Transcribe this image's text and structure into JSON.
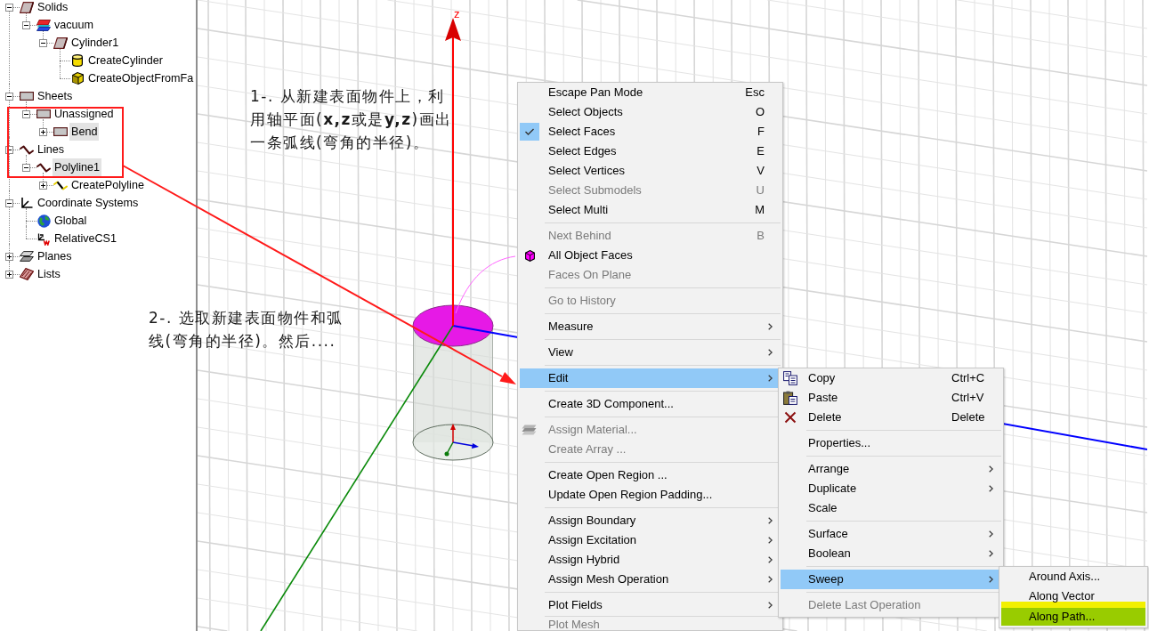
{
  "tree": [
    {
      "label": "Solids",
      "kind": "solid",
      "expanded": true,
      "selected": false,
      "children": [
        {
          "label": "vacuum",
          "kind": "material",
          "expanded": true,
          "selected": false,
          "children": [
            {
              "label": "Cylinder1",
              "kind": "solid",
              "expanded": true,
              "selected": false,
              "children": [
                {
                  "label": "CreateCylinder",
                  "kind": "cylinder",
                  "selected": false
                },
                {
                  "label": "CreateObjectFromFa",
                  "kind": "block",
                  "selected": false
                }
              ]
            }
          ]
        }
      ]
    },
    {
      "label": "Sheets",
      "kind": "sheet",
      "expanded": true,
      "selected": false,
      "children": [
        {
          "label": "Unassigned",
          "kind": "sheet",
          "expanded": true,
          "selected": false,
          "children": [
            {
              "label": "Bend",
              "kind": "sheet",
              "expanded": false,
              "selected": true
            }
          ]
        }
      ]
    },
    {
      "label": "Lines",
      "kind": "line",
      "expanded": true,
      "selected": false,
      "children": [
        {
          "label": "Polyline1",
          "kind": "line",
          "expanded": true,
          "selected": true,
          "children": [
            {
              "label": "CreatePolyline",
              "kind": "path",
              "expanded": false,
              "selected": false
            }
          ]
        }
      ]
    },
    {
      "label": "Coordinate Systems",
      "kind": "axes",
      "expanded": true,
      "selected": false,
      "children": [
        {
          "label": "Global",
          "kind": "globe",
          "selected": false
        },
        {
          "label": "RelativeCS1",
          "kind": "relcs",
          "selected": false
        }
      ]
    },
    {
      "label": "Planes",
      "kind": "planes",
      "expanded": false,
      "selected": false
    },
    {
      "label": "Lists",
      "kind": "lists",
      "expanded": false,
      "selected": false
    }
  ],
  "notes": [
    "1-. 从新建表面物件上，利用轴平面(**x,z**或是**y,z**)画出一条弧线(弯角的半径)。",
    "2-. 选取新建表面物件和弧线(弯角的半径)。然后...."
  ],
  "viewport": {
    "axis_label": "z"
  },
  "context_menu": {
    "sections": [
      [
        {
          "label": "Escape Pan Mode",
          "shortcut": "Esc",
          "checked": false,
          "disabled": false,
          "submenu": false,
          "selected": false
        },
        {
          "label": "Select Objects",
          "shortcut": "O",
          "checked": false,
          "disabled": false,
          "submenu": false,
          "selected": false
        },
        {
          "label": "Select Faces",
          "shortcut": "F",
          "checked": true,
          "disabled": false,
          "submenu": false,
          "selected": false
        },
        {
          "label": "Select Edges",
          "shortcut": "E",
          "checked": false,
          "disabled": false,
          "submenu": false,
          "selected": false
        },
        {
          "label": "Select Vertices",
          "shortcut": "V",
          "checked": false,
          "disabled": false,
          "submenu": false,
          "selected": false
        },
        {
          "label": "Select Submodels",
          "shortcut": "U",
          "checked": false,
          "disabled": true,
          "submenu": false,
          "selected": false
        },
        {
          "label": "Select Multi",
          "shortcut": "M",
          "checked": false,
          "disabled": false,
          "submenu": false,
          "selected": false
        }
      ],
      [
        {
          "label": "Next Behind",
          "shortcut": "B",
          "kind": "plain",
          "disabled": true,
          "submenu": false,
          "selected": false
        },
        {
          "label": "All Object Faces",
          "kind": "faces",
          "disabled": false,
          "submenu": false,
          "selected": false
        },
        {
          "label": "Faces On Plane",
          "kind": "plain",
          "disabled": true,
          "submenu": false,
          "selected": false
        }
      ],
      [
        {
          "label": "Go to History",
          "disabled": true,
          "submenu": false,
          "selected": false
        }
      ],
      [
        {
          "label": "Measure",
          "disabled": false,
          "submenu": true,
          "selected": false
        }
      ],
      [
        {
          "label": "View",
          "disabled": false,
          "submenu": true,
          "selected": false
        }
      ],
      [
        {
          "label": "Edit",
          "disabled": false,
          "submenu": true,
          "selected": true
        }
      ],
      [
        {
          "label": "Create 3D Component...",
          "disabled": false,
          "submenu": false,
          "selected": false
        }
      ],
      [
        {
          "label": "Assign Material...",
          "kind": "material",
          "disabled": true,
          "submenu": false,
          "selected": false
        },
        {
          "label": "Create Array ...",
          "kind": "plain",
          "disabled": true,
          "submenu": false,
          "selected": false
        }
      ],
      [
        {
          "label": "Create Open Region ...",
          "disabled": false,
          "submenu": false,
          "selected": false
        },
        {
          "label": "Update Open Region Padding...",
          "disabled": false,
          "submenu": false,
          "selected": false
        }
      ],
      [
        {
          "label": "Assign Boundary",
          "disabled": false,
          "submenu": true,
          "selected": false
        },
        {
          "label": "Assign Excitation",
          "disabled": false,
          "submenu": true,
          "selected": false
        },
        {
          "label": "Assign Hybrid",
          "disabled": false,
          "submenu": true,
          "selected": false
        },
        {
          "label": "Assign Mesh Operation",
          "disabled": false,
          "submenu": true,
          "selected": false
        }
      ],
      [
        {
          "label": "Plot Fields",
          "disabled": false,
          "submenu": true,
          "selected": false
        }
      ],
      [
        {
          "label": "Plot Mesh",
          "disabled": true,
          "submenu": false,
          "selected": false
        }
      ]
    ]
  },
  "edit_submenu": {
    "sections": [
      [
        {
          "label": "Copy",
          "shortcut": "Ctrl+C",
          "kind": "copy",
          "disabled": false,
          "submenu": false,
          "selected": false
        },
        {
          "label": "Paste",
          "shortcut": "Ctrl+V",
          "kind": "paste",
          "disabled": false,
          "submenu": false,
          "selected": false
        },
        {
          "label": "Delete",
          "shortcut": "Delete",
          "kind": "delete",
          "disabled": false,
          "submenu": false,
          "selected": false
        }
      ],
      [
        {
          "label": "Properties...",
          "disabled": false,
          "submenu": false,
          "selected": false
        }
      ],
      [
        {
          "label": "Arrange",
          "disabled": false,
          "submenu": true,
          "selected": false
        },
        {
          "label": "Duplicate",
          "disabled": false,
          "submenu": true,
          "selected": false
        },
        {
          "label": "Scale",
          "disabled": false,
          "submenu": false,
          "selected": false
        }
      ],
      [
        {
          "label": "Surface",
          "disabled": false,
          "submenu": true,
          "selected": false
        },
        {
          "label": "Boolean",
          "disabled": false,
          "submenu": true,
          "selected": false
        }
      ],
      [
        {
          "label": "Sweep",
          "disabled": false,
          "submenu": true,
          "selected": true
        }
      ],
      [
        {
          "label": "Delete Last Operation",
          "disabled": true,
          "submenu": false,
          "selected": false
        }
      ]
    ]
  },
  "sweep_submenu": {
    "items": [
      {
        "label": "Around Axis...",
        "selected": false
      },
      {
        "label": "Along Vector",
        "selected": false
      },
      {
        "label": "Along Path...",
        "selected": true
      }
    ]
  }
}
